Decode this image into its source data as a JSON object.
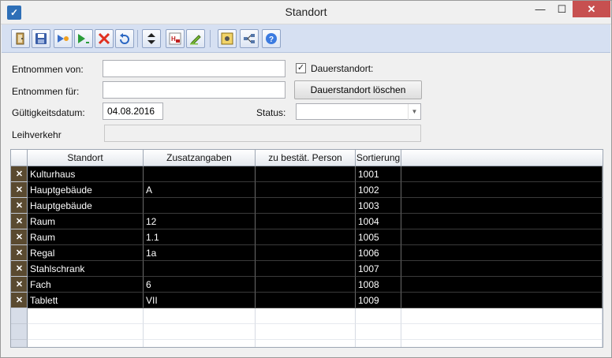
{
  "window": {
    "title": "Standort",
    "min_glyph": "—",
    "max_glyph": "☐",
    "close_glyph": "✕"
  },
  "toolbar": {
    "buttons": [
      {
        "name": "exit-icon"
      },
      {
        "name": "save-icon"
      },
      {
        "name": "forward-icon"
      },
      {
        "name": "run-icon"
      },
      {
        "name": "delete-icon"
      },
      {
        "name": "undo-icon"
      },
      {
        "name": "up-down-icon"
      },
      {
        "name": "hl-icon"
      },
      {
        "name": "edit-icon"
      },
      {
        "name": "settings-icon"
      },
      {
        "name": "network-icon"
      },
      {
        "name": "help-icon"
      }
    ]
  },
  "form": {
    "entnommen_von_label": "Entnommen von:",
    "entnommen_von_value": "",
    "entnommen_fuer_label": "Entnommen für:",
    "entnommen_fuer_value": "",
    "dauerstandort_label": "Dauerstandort:",
    "dauerstandort_checked": true,
    "dauerstandort_check_glyph": "✓",
    "dauerstandort_loeschen_label": "Dauerstandort löschen",
    "gueltigkeitsdatum_label": "Gültigkeitsdatum:",
    "gueltigkeitsdatum_value": "04.08.2016",
    "status_label": "Status:",
    "status_value": "",
    "status_arrow": "▼",
    "leihverkehr_label": "Leihverkehr",
    "leihverkehr_value": ""
  },
  "grid": {
    "columns": [
      "Standort",
      "Zusatzangaben",
      "zu bestät. Person",
      "Sortierung"
    ],
    "row_delete_glyph": "✕",
    "rows": [
      {
        "standort": "Kulturhaus",
        "zusatz": "",
        "person": "",
        "sortierung": "1001"
      },
      {
        "standort": "Hauptgebäude",
        "zusatz": "A",
        "person": "",
        "sortierung": "1002"
      },
      {
        "standort": "Hauptgebäude",
        "zusatz": "",
        "person": "",
        "sortierung": "1003"
      },
      {
        "standort": "Raum",
        "zusatz": "12",
        "person": "",
        "sortierung": "1004"
      },
      {
        "standort": "Raum",
        "zusatz": "1.1",
        "person": "",
        "sortierung": "1005"
      },
      {
        "standort": "Regal",
        "zusatz": "1a",
        "person": "",
        "sortierung": "1006"
      },
      {
        "standort": "Stahlschrank",
        "zusatz": "",
        "person": "",
        "sortierung": "1007"
      },
      {
        "standort": "Fach",
        "zusatz": "6",
        "person": "",
        "sortierung": "1008"
      },
      {
        "standort": "Tablett",
        "zusatz": "VII",
        "person": "",
        "sortierung": "1009"
      }
    ]
  }
}
